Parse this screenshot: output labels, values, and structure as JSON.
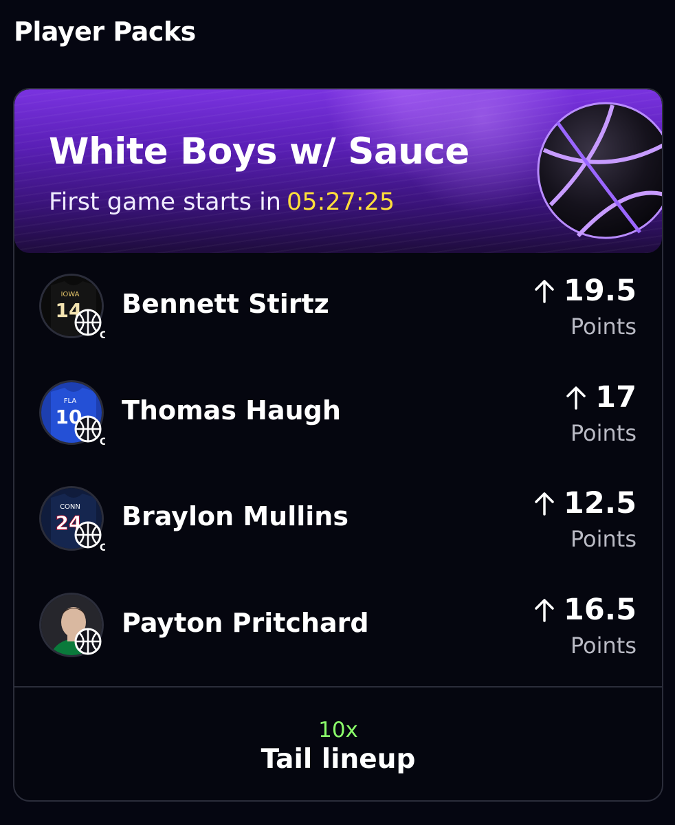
{
  "section": {
    "title": "Player Packs"
  },
  "pack": {
    "name": "White Boys w/ Sauce",
    "start_label": "First game starts in",
    "countdown": "05:27:25"
  },
  "players": [
    {
      "name": "Bennett Stirtz",
      "line": "19.5",
      "unit": "Points",
      "direction": "up",
      "jersey_team": "IOWA",
      "jersey_number": "14",
      "league_tag": "C"
    },
    {
      "name": "Thomas Haugh",
      "line": "17",
      "unit": "Points",
      "direction": "up",
      "jersey_team": "FLA",
      "jersey_number": "10",
      "league_tag": "C"
    },
    {
      "name": "Braylon Mullins",
      "line": "12.5",
      "unit": "Points",
      "direction": "up",
      "jersey_team": "CONN",
      "jersey_number": "24",
      "league_tag": "C"
    },
    {
      "name": "Payton Pritchard",
      "line": "16.5",
      "unit": "Points",
      "direction": "up"
    }
  ],
  "tail": {
    "multiplier": "10x",
    "label": "Tail lineup"
  },
  "colors": {
    "background": "#050611",
    "banner_purple": "#5a1fb6",
    "countdown_yellow": "#ffdf3a",
    "multiplier_green": "#8bff6a",
    "muted_text": "#b9bac4",
    "border": "#2b2d3a"
  },
  "icons": {
    "arrow": "arrow-up-icon",
    "sport": "basketball-icon",
    "banner": "basketball-icon"
  }
}
